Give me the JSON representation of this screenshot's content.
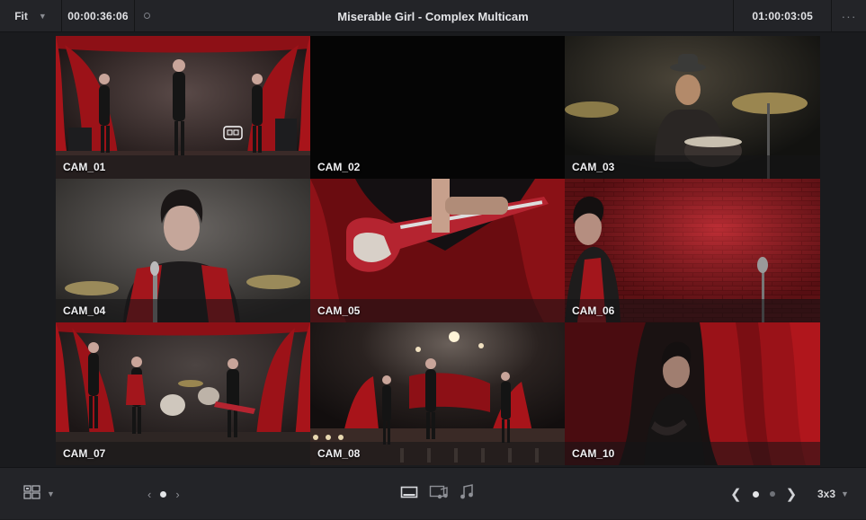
{
  "topbar": {
    "fit_label": "Fit",
    "source_timecode": "00:00:36:06",
    "title": "Miserable Girl - Complex Multicam",
    "record_timecode": "01:00:03:05",
    "more_label": "···"
  },
  "viewer": {
    "angles": [
      {
        "label": "CAM_01",
        "selected": true
      },
      {
        "label": "CAM_02",
        "selected": false
      },
      {
        "label": "CAM_03",
        "selected": false
      },
      {
        "label": "CAM_04",
        "selected": false
      },
      {
        "label": "CAM_05",
        "selected": false
      },
      {
        "label": "CAM_06",
        "selected": false
      },
      {
        "label": "CAM_07",
        "selected": false
      },
      {
        "label": "CAM_08",
        "selected": false
      },
      {
        "label": "CAM_10",
        "selected": false
      }
    ]
  },
  "bottombar": {
    "grid_size": "3x3",
    "prev_arrow": "‹",
    "next_arrow": "›",
    "page_prev": "❮",
    "page_next": "❯"
  },
  "colors": {
    "accent_selected": "#e8e9ec",
    "curtain_red": "#a8141a",
    "background": "#1a1b1e"
  }
}
